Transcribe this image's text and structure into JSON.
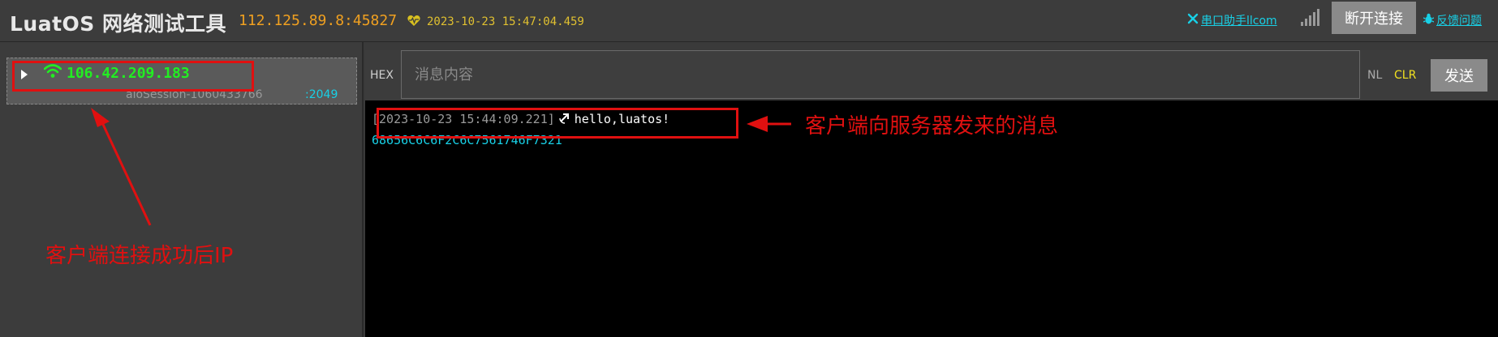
{
  "header": {
    "app_title": "LuatOS 网络测试工具",
    "server_address": "112.125.89.8:45827",
    "server_time": "2023-10-23 15:47:04.459",
    "serial_link": "串口助手llcom",
    "disconnect_label": "断开连接",
    "feedback_link": "反馈问题"
  },
  "client": {
    "ip": "106.42.209.183",
    "session": "aioSession-1060433766",
    "port": ":2049"
  },
  "input_bar": {
    "hex_label": "HEX",
    "message_placeholder": "消息内容",
    "nl_label": "NL",
    "clr_label": "CLR",
    "send_label": "发送"
  },
  "log": {
    "timestamp": "[2023-10-23 15:44:09.221]",
    "text": "hello,luatos!",
    "hex": "68656C6C6F2C6C7561746F7321"
  },
  "annotations": {
    "client_ip_note": "客户端连接成功后IP",
    "message_note": "客户端向服务器发来的消息"
  },
  "colors": {
    "accent_green": "#22ee22",
    "accent_cyan": "#18d0e6",
    "address_orange": "#f0a020",
    "annotation_red": "#e01010"
  }
}
